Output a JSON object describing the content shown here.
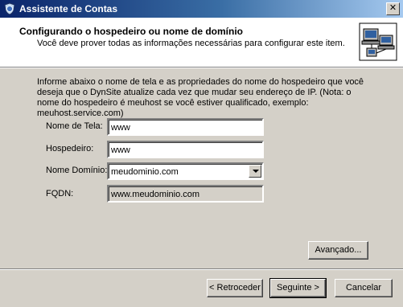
{
  "window": {
    "title": "Assistente de Contas",
    "close_label": "✕"
  },
  "header": {
    "title": "Configurando o hospedeiro ou nome de domínio",
    "subtitle": "Você deve prover todas as informações necessárias para configurar este item."
  },
  "info_text": "Informe abaixo o nome de tela e as propriedades do nome do hospedeiro que você deseja que o DynSite atualize cada vez que mudar seu endereço de IP. (Nota: o nome do hospedeiro é meuhost se você estiver qualificado, exemplo:  meuhost.service.com)",
  "form": {
    "screen_name": {
      "label": "Nome de Tela:",
      "value": "www"
    },
    "host": {
      "label": "Hospedeiro:",
      "value": "www"
    },
    "domain": {
      "label": "Nome Domínio:",
      "value": "meudominio.com"
    },
    "fqdn": {
      "label": "FQDN:",
      "value": "www.meudominio.com"
    }
  },
  "buttons": {
    "advanced": "Avançado...",
    "back": "< Retroceder",
    "next": "Seguinte >",
    "cancel": "Cancelar"
  },
  "icons": {
    "app": "shield-globe-icon",
    "header": "computers-network-icon"
  },
  "colors": {
    "titlebar_start": "#0a246a",
    "titlebar_end": "#a6caf0",
    "face": "#d4d0c8"
  }
}
